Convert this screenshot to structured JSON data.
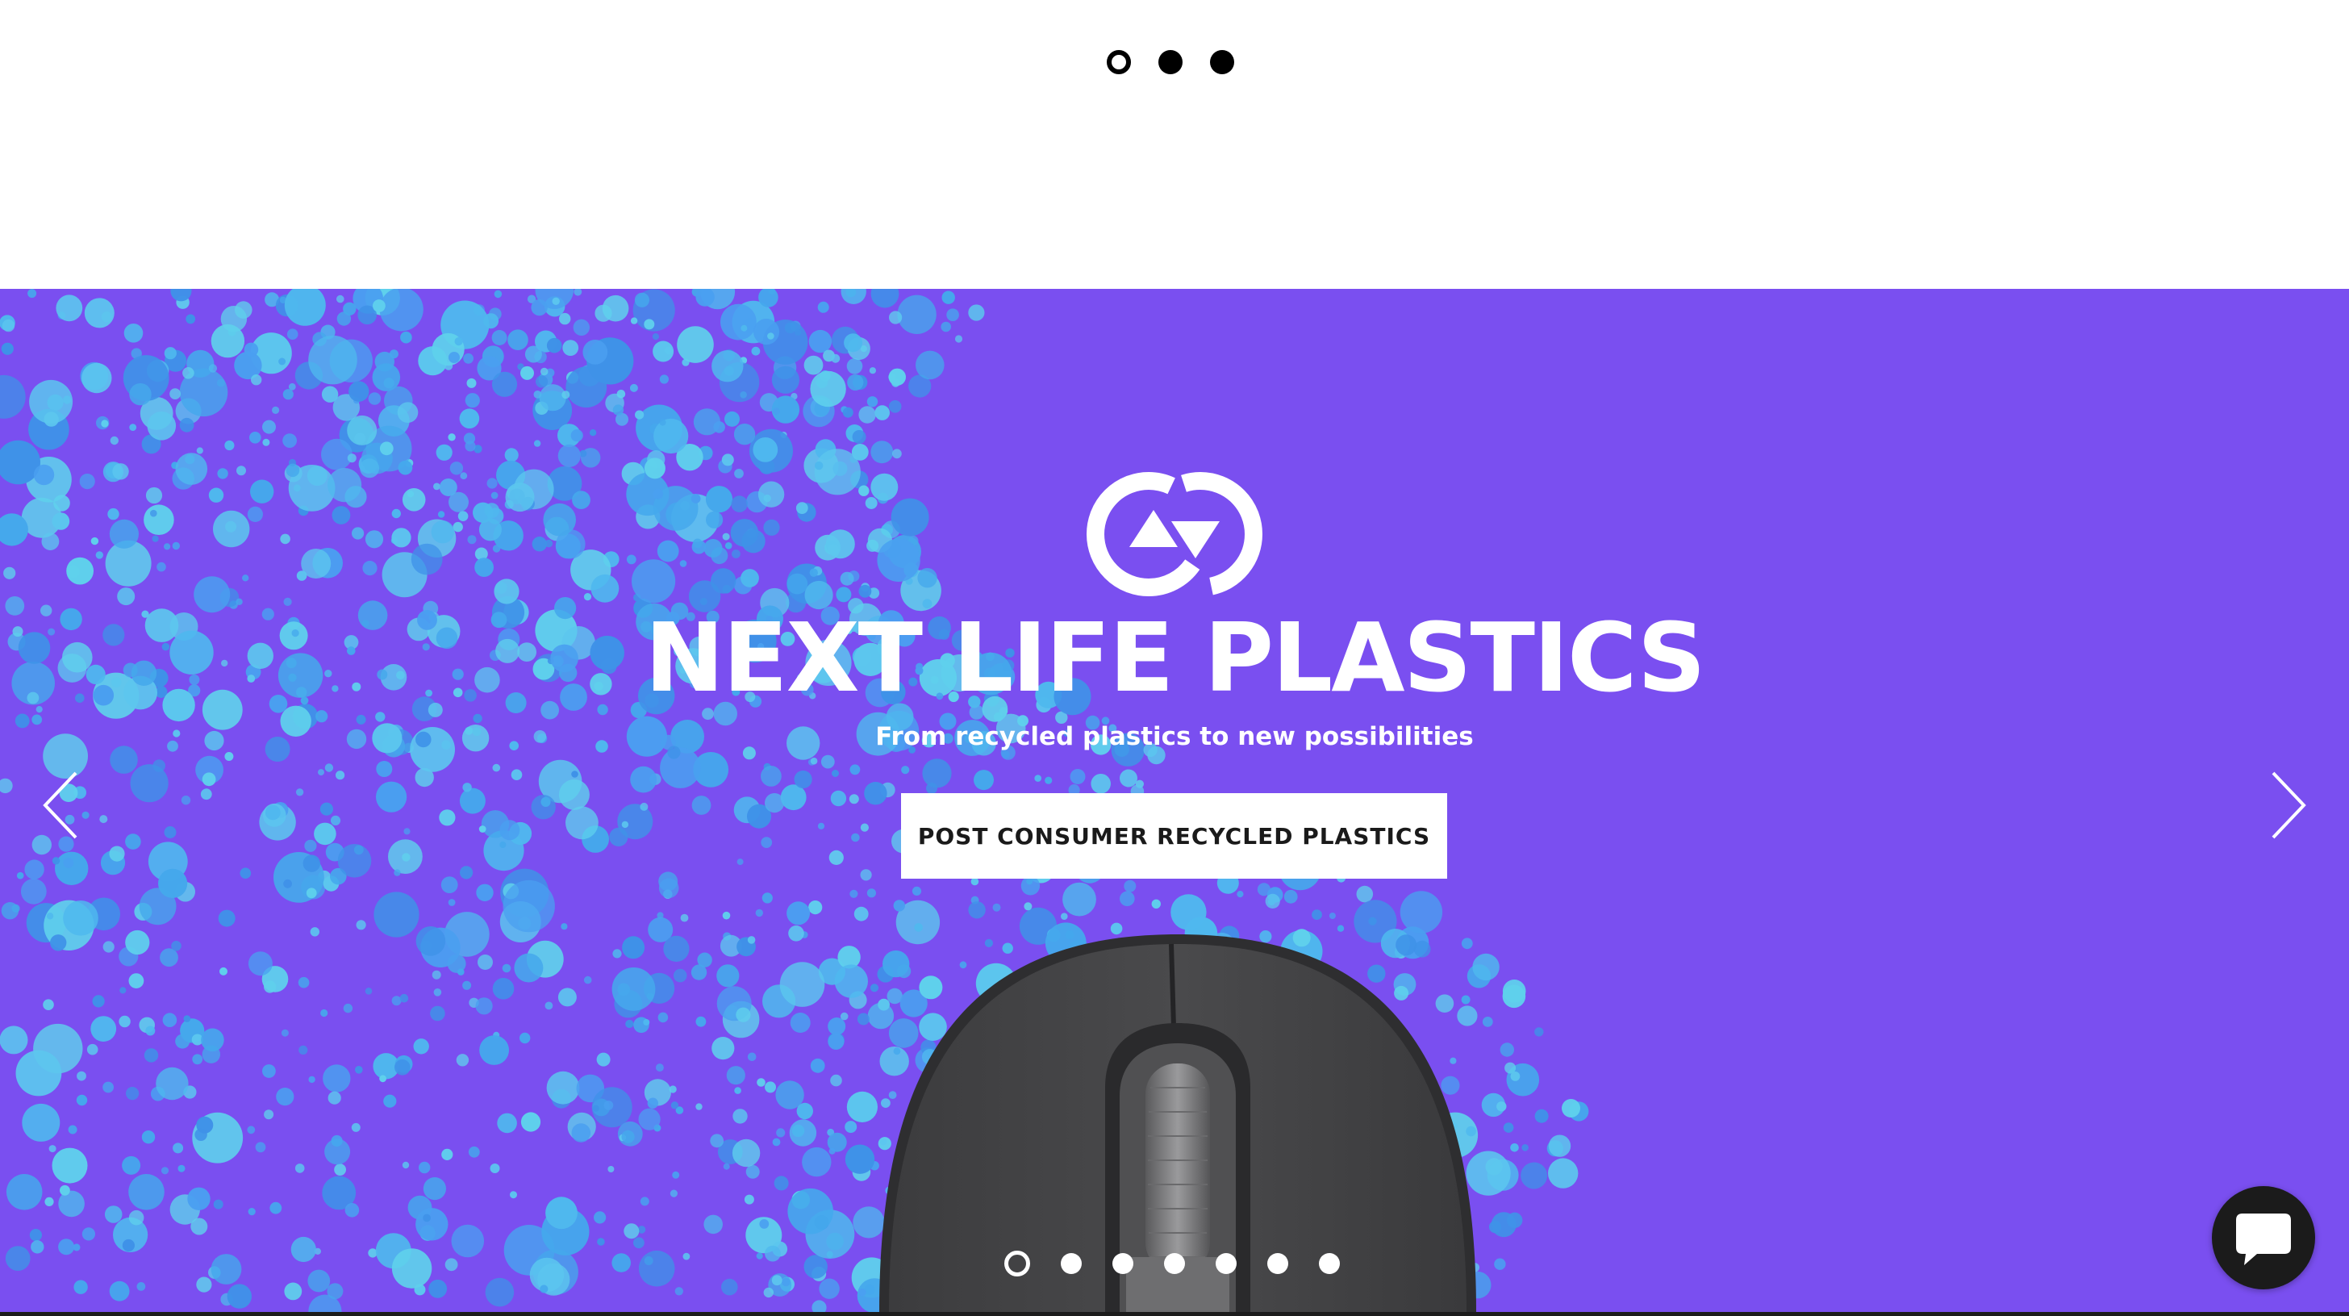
{
  "top_carousel": {
    "dots": [
      {
        "label": "slide 1",
        "active": true
      },
      {
        "label": "slide 2",
        "active": false
      },
      {
        "label": "slide 3",
        "active": false
      }
    ]
  },
  "hero": {
    "background_color": "#7a4ff0",
    "bubble_color": "#4fb8ee",
    "logo_icon": "recycle-arrows-icon",
    "title": "NEXT LIFE PLASTICS",
    "subtitle": "From recycled plastics to new possibilities",
    "cta_label": "POST CONSUMER RECYCLED PLASTICS",
    "prev_icon": "chevron-left-icon",
    "next_icon": "chevron-right-icon",
    "product_image": "computer-mouse",
    "dots": [
      {
        "label": "slide 1",
        "active": true
      },
      {
        "label": "slide 2",
        "active": false
      },
      {
        "label": "slide 3",
        "active": false
      },
      {
        "label": "slide 4",
        "active": false
      },
      {
        "label": "slide 5",
        "active": false
      },
      {
        "label": "slide 6",
        "active": false
      },
      {
        "label": "slide 7",
        "active": false
      }
    ]
  },
  "chat": {
    "icon": "chat-bubble-icon",
    "background_color": "#1b1b1b"
  }
}
